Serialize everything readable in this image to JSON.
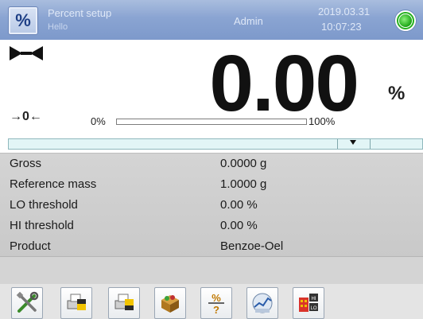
{
  "header": {
    "mode_icon_label": "%",
    "title": "Percent setup",
    "subtitle": "Hello",
    "user": "Admin",
    "date": "2019.03.31",
    "time": "10:07:23",
    "status_icon": "green-led-icon"
  },
  "display": {
    "value": "0.00",
    "unit": "%",
    "stability_icon": "stable-bowtie-icon",
    "zero_indicator": "→0←",
    "bar_min_label": "0%",
    "bar_max_label": "100%",
    "bar_fill_fraction": 0.0
  },
  "threshold_strip": {
    "marker_icon": "down-triangle-icon"
  },
  "info": [
    {
      "label": "Gross",
      "value": "0.0000 g"
    },
    {
      "label": "Reference mass",
      "value": "1.0000 g"
    },
    {
      "label": "LO threshold",
      "value": "0.00 %"
    },
    {
      "label": "HI threshold",
      "value": "0.00 %"
    },
    {
      "label": "Product",
      "value": "Benzoe-Oel"
    }
  ],
  "toolbar": {
    "buttons": [
      {
        "icon": "settings-tools-icon"
      },
      {
        "icon": "printer-header-icon"
      },
      {
        "icon": "printer-footer-icon"
      },
      {
        "icon": "product-database-icon"
      },
      {
        "icon": "percent-reference-icon"
      },
      {
        "icon": "chart-statistics-icon"
      },
      {
        "icon": "hi-lo-thresholds-icon"
      }
    ]
  },
  "colors": {
    "header_bg": "#8aa4d2",
    "panel_bg": "#d4d4d4",
    "strip_bg": "#e2f5f6",
    "led_green": "#1aa514"
  }
}
